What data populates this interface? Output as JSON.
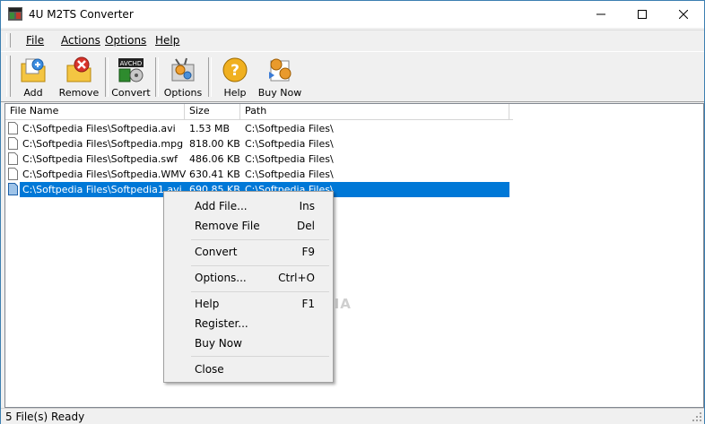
{
  "window": {
    "title": "4U M2TS Converter"
  },
  "menu": [
    {
      "label": "File",
      "key": "F"
    },
    {
      "label": "Actions",
      "key": "A"
    },
    {
      "label": "Options",
      "key": "O"
    },
    {
      "label": "Help",
      "key": "H"
    }
  ],
  "toolbar": {
    "add": "Add",
    "remove": "Remove",
    "convert": "Convert",
    "options": "Options",
    "help": "Help",
    "buy_now": "Buy Now"
  },
  "list": {
    "columns": [
      "File Name",
      "Size",
      "Path"
    ],
    "rows": [
      {
        "name": "C:\\Softpedia Files\\Softpedia.avi",
        "size": "1.53 MB",
        "path": "C:\\Softpedia Files\\"
      },
      {
        "name": "C:\\Softpedia Files\\Softpedia.mpg",
        "size": "818.00 KB",
        "path": "C:\\Softpedia Files\\"
      },
      {
        "name": "C:\\Softpedia Files\\Softpedia.swf",
        "size": "486.06 KB",
        "path": "C:\\Softpedia Files\\"
      },
      {
        "name": "C:\\Softpedia Files\\Softpedia.WMV",
        "size": "630.41 KB",
        "path": "C:\\Softpedia Files\\"
      },
      {
        "name": "C:\\Softpedia Files\\Softpedia1.avi",
        "size": "690.85 KB",
        "path": "C:\\Softpedia Files\\"
      }
    ],
    "selected_index": 4
  },
  "context_menu": [
    {
      "label": "Add File...",
      "shortcut": "Ins"
    },
    {
      "label": "Remove File",
      "shortcut": "Del"
    },
    {
      "label": "Convert",
      "shortcut": "F9"
    },
    {
      "label": "Options...",
      "shortcut": "Ctrl+O"
    },
    {
      "label": "Help",
      "shortcut": "F1"
    },
    {
      "label": "Register...",
      "shortcut": ""
    },
    {
      "label": "Buy Now",
      "shortcut": ""
    },
    {
      "label": "Close",
      "shortcut": ""
    }
  ],
  "status": {
    "text": "5 File(s) Ready"
  },
  "watermark": "SOFTPEDIA",
  "colors": {
    "selection": "#0078d7",
    "window_border": "#3c7fb1"
  }
}
